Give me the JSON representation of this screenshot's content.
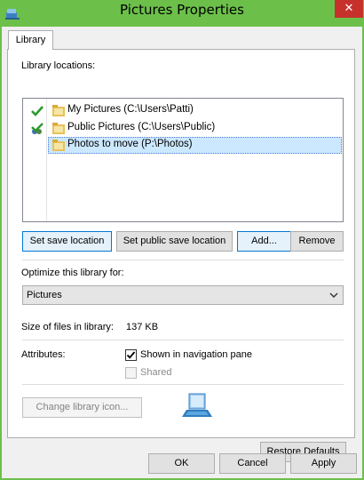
{
  "window": {
    "title": "Pictures Properties",
    "close_glyph": "✕",
    "accent_color": "#6cc04a",
    "close_color": "#c7312c"
  },
  "tabs": [
    {
      "label": "Library",
      "active": true
    }
  ],
  "library_locations": {
    "label": "Library locations:",
    "items": [
      {
        "label": "My Pictures (C:\\Users\\Patti)",
        "status_icon": "green-check-icon",
        "selected": false
      },
      {
        "label": "Public Pictures (C:\\Users\\Public)",
        "status_icon": "public-save-check-icon",
        "selected": false
      },
      {
        "label": "Photos to move (P:\\Photos)",
        "status_icon": "",
        "selected": true
      }
    ]
  },
  "location_buttons": {
    "set_save": "Set save location",
    "set_public_save": "Set public save location",
    "add": "Add...",
    "remove": "Remove"
  },
  "optimize": {
    "label": "Optimize this library for:",
    "selected": "Pictures"
  },
  "size": {
    "label": "Size of files in library:",
    "value": "137 KB"
  },
  "attributes": {
    "label": "Attributes:",
    "shown_in_nav": {
      "label": "Shown in navigation pane",
      "checked": true,
      "enabled": true
    },
    "shared": {
      "label": "Shared",
      "checked": false,
      "enabled": false
    }
  },
  "change_icon_button": "Change library icon...",
  "restore_defaults_button": "Restore Defaults",
  "footer": {
    "ok": "OK",
    "cancel": "Cancel",
    "apply": "Apply"
  }
}
